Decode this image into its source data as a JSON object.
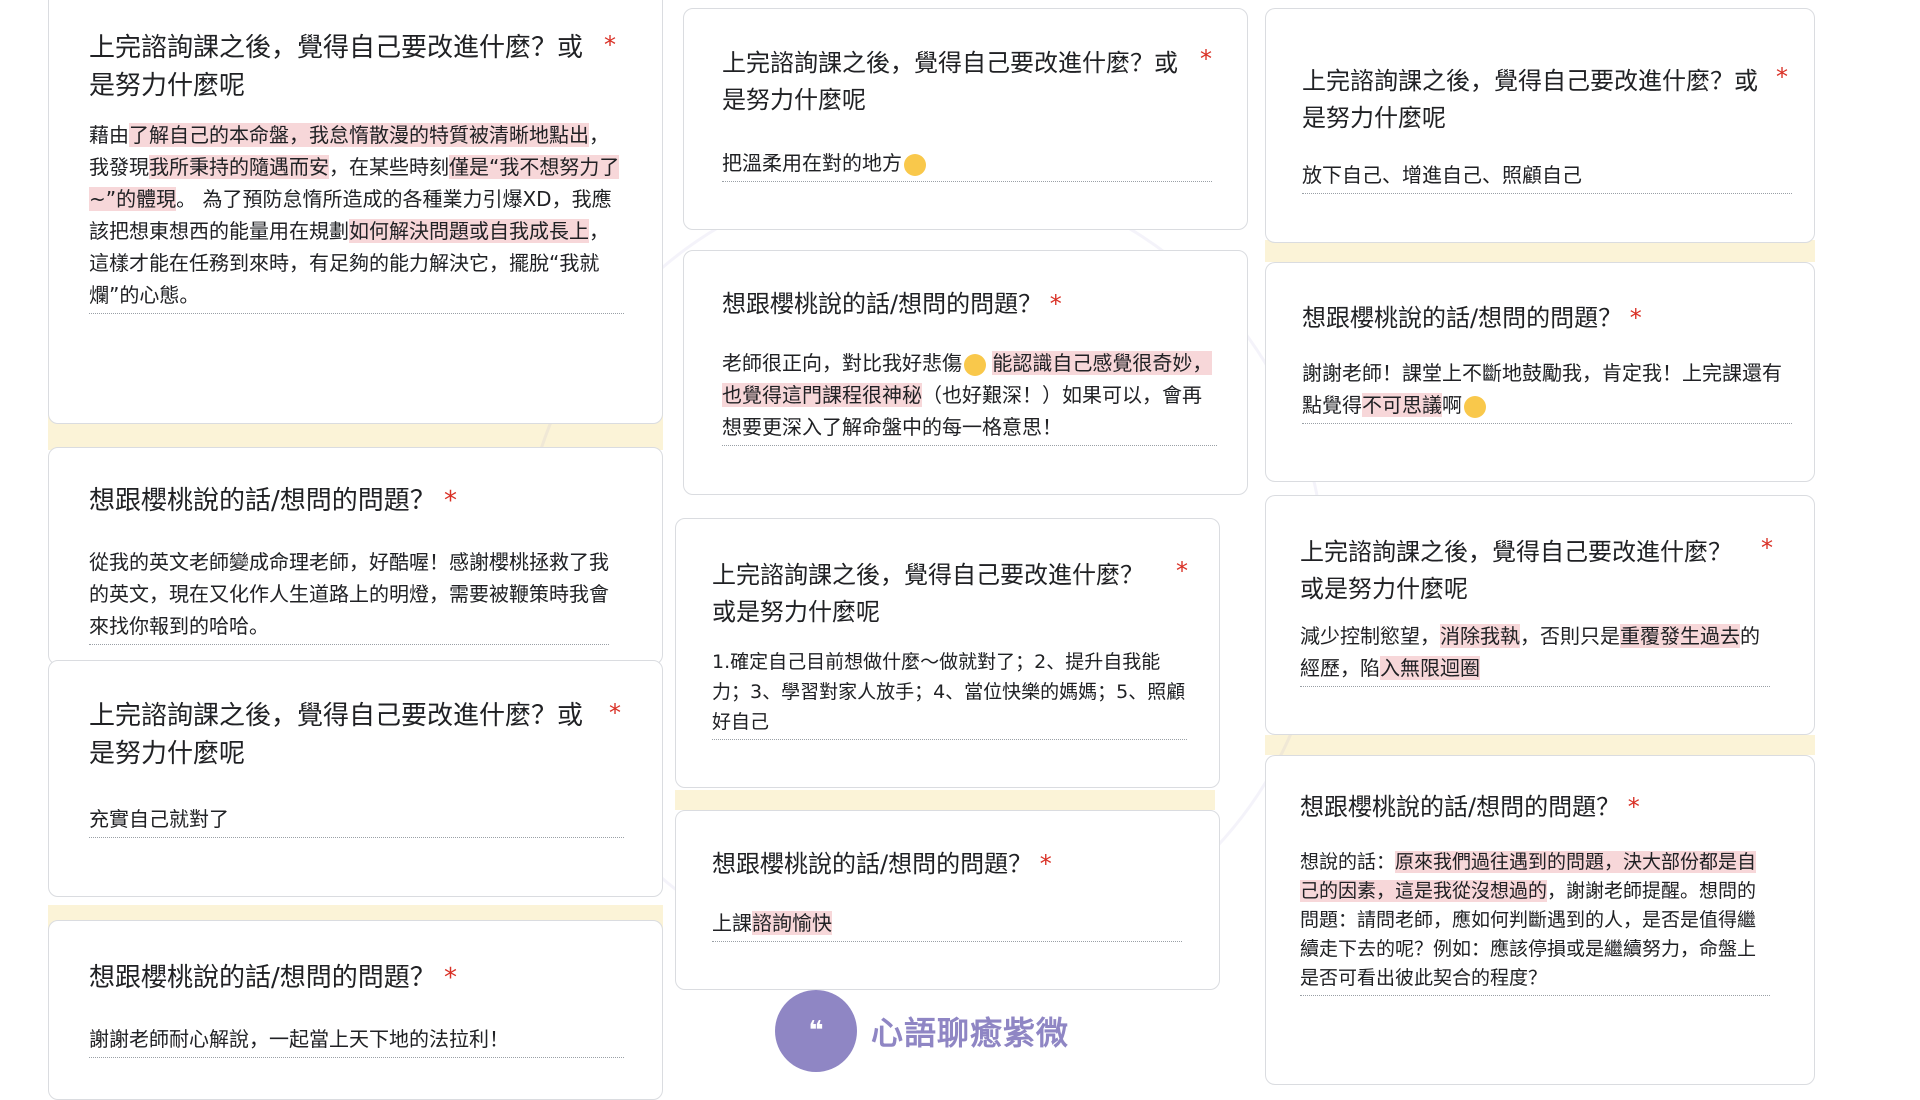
{
  "questions": {
    "improve": "上完諮詢課之後，覺得自己要改進什麼？或是努力什麼呢",
    "ask": "想跟櫻桃說的話/想問的問題？",
    "required": "*"
  },
  "col1": {
    "a1": {
      "p1": "藉由",
      "h1": "了解自己的本命盤，我怠惰散漫的特質被清晰地點出",
      "p2": "，我發現",
      "h2": "我所秉持的隨遇而安",
      "p3": "，在某些時刻",
      "h3": "僅是“我不想努力了~”的體現",
      "p4": "。 為了預防怠惰所造成的各種業力引爆XD，我應該把想東想西的能量用在規劃",
      "h4": "如何解決問題或自我成長上",
      "p5": "，這樣才能在任務到來時，有足夠的能力解決它，擺脫“我就爛”的心態。"
    },
    "a2": "從我的英文老師變成命理老師，好酷喔！感謝櫻桃拯救了我的英文，現在又化作人生道路上的明燈，需要被鞭策時我會來找你報到的哈哈。",
    "a3": "充實自己就對了",
    "a4": "謝謝老師耐心解說，一起當上天下地的法拉利！"
  },
  "col2": {
    "a1": "把溫柔用在對的地方",
    "a2": {
      "p1": "老師很正向，對比我好悲傷",
      "h1": "能認識自己感覺很奇妙，也覺得這門課程很神秘",
      "p2": "（也好艱深！）如果可以，會再想要更深入了解命盤中的每一格意思！"
    },
    "a3": "1.確定自己目前想做什麼～做就對了；2、提升自我能力；3、學習對家人放手；4、當位快樂的媽媽；5、照顧好自己",
    "a4": {
      "p1": "上課",
      "h1": "諮詢愉快"
    }
  },
  "col3": {
    "a1": "放下自己、增進自己、照顧自己",
    "a2": {
      "p1": "謝謝老師！課堂上不斷地鼓勵我，肯定我！上完課還有點覺得",
      "h1": "不可思議",
      "p2": "啊"
    },
    "a3": {
      "p1": "減少控制慾望，",
      "h1": "消除我執",
      "p2": "，否則只是",
      "h2": "重覆發生過去",
      "p3": "的經歷，陷",
      "h3": "入無限迴圈"
    },
    "a4": {
      "p1": "想說的話：",
      "h1": "原來我們過往遇到的問題，決大部份都是自己的因素，這是我從沒想過的",
      "p2": "，謝謝老師提醒。想問的問題：請問老師，應如何判斷遇到的人，是否是值得繼續走下去的呢？例如：應該停損或是繼續努力，命盤上是否可看出彼此契合的程度？"
    }
  },
  "brand": {
    "name": "心語聊癒紫微"
  },
  "colors": {
    "highlight": "#f7d7d9",
    "band": "#fbf3d7",
    "brand": "#8f86c4",
    "required": "#d93025"
  }
}
